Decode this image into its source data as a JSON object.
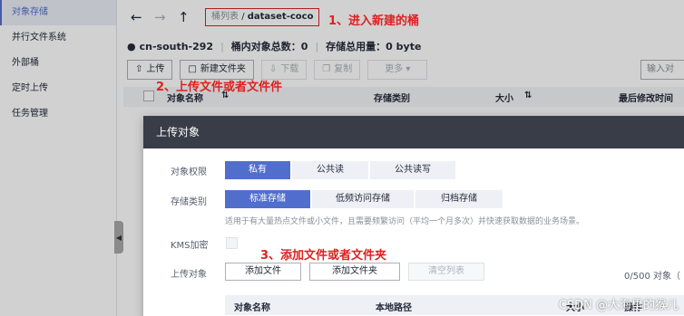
{
  "sidebar": {
    "items": [
      {
        "label": "对象存储",
        "active": true
      },
      {
        "label": "并行文件系统"
      },
      {
        "label": "外部桶"
      },
      {
        "label": "定时上传"
      },
      {
        "label": "任务管理"
      }
    ]
  },
  "nav": {
    "back_icon": "arrow-left",
    "forward_icon": "arrow-right",
    "up_icon": "arrow-up",
    "breadcrumb_parent": "桶列表",
    "breadcrumb_sep": "/",
    "breadcrumb_current": "dataset-coco"
  },
  "annotations": {
    "step1": "1、进入新建的桶",
    "step2": "2、上传文件或者文件件",
    "step3": "3、添加文件或者文件夹"
  },
  "bucket_info": {
    "region": "cn-south-292",
    "object_count_label": "桶内对象总数：",
    "object_count": "0",
    "storage_label": "存储总用量：",
    "storage_value": "0 byte"
  },
  "toolbar": {
    "upload": "上传",
    "new_folder": "新建文件夹",
    "download": "下载",
    "copy": "复制",
    "more": "更多",
    "search_placeholder": "输入对"
  },
  "table": {
    "columns": [
      "对象名称",
      "存储类别",
      "大小",
      "最后修改时间"
    ]
  },
  "dialog": {
    "title": "上传对象",
    "acl_label": "对象权限",
    "acl_options": [
      "私有",
      "公共读",
      "公共读写"
    ],
    "acl_selected": "私有",
    "storage_label": "存储类别",
    "storage_options": [
      "标准存储",
      "低频访问存储",
      "归档存储"
    ],
    "storage_selected": "标准存储",
    "storage_hint": "适用于有大量热点文件或小文件，且需要频繁访问（平均一个月多次）并快速获取数据的业务场景。",
    "kms_label": "KMS加密",
    "upload_label": "上传对象",
    "add_file": "添加文件",
    "add_folder": "添加文件夹",
    "clear_list": "清空列表",
    "count_text": "0/500 对象（",
    "columns": [
      "对象名称",
      "本地路径",
      "大小",
      "操作"
    ]
  },
  "watermark": "CSDN @大海里的猴儿",
  "colors": {
    "accent": "#526ecc",
    "annotation": "#e02020",
    "dialog_header": "#383d47"
  }
}
